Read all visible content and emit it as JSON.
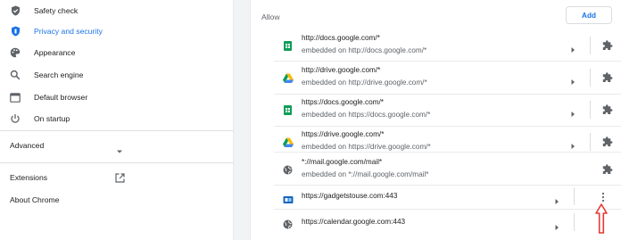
{
  "sidebar": {
    "items": [
      {
        "label": "Safety check",
        "icon": "shield-check-icon"
      },
      {
        "label": "Privacy and security",
        "icon": "shield-icon",
        "active": true
      },
      {
        "label": "Appearance",
        "icon": "palette-icon"
      },
      {
        "label": "Search engine",
        "icon": "search-icon"
      },
      {
        "label": "Default browser",
        "icon": "browser-icon"
      },
      {
        "label": "On startup",
        "icon": "power-icon"
      }
    ],
    "advanced_label": "Advanced",
    "extensions_label": "Extensions",
    "about_label": "About Chrome"
  },
  "main": {
    "section_title": "Allow",
    "add_label": "Add",
    "rows": [
      {
        "site": "http://docs.google.com/*",
        "embedded": "embedded on http://docs.google.com/*",
        "favicon": "google-docs-icon"
      },
      {
        "site": "http://drive.google.com/*",
        "embedded": "embedded on http://drive.google.com/*",
        "favicon": "google-drive-icon"
      },
      {
        "site": "https://docs.google.com/*",
        "embedded": "embedded on https://docs.google.com/*",
        "favicon": "google-docs-icon"
      },
      {
        "site": "https://drive.google.com/*",
        "embedded": "embedded on https://drive.google.com/*",
        "favicon": "google-drive-icon"
      },
      {
        "site": "*://mail.google.com/mail*",
        "embedded": "embedded on *://mail.google.com/mail*",
        "favicon": "globe-icon"
      },
      {
        "site": "https://gadgetstouse.com:443",
        "favicon": "gadgetstouse-icon"
      },
      {
        "site": "https://calendar.google.com:443",
        "favicon": "globe-icon"
      }
    ]
  },
  "colors": {
    "accent": "#1a73e8",
    "annotation_arrow": "#e53935"
  }
}
